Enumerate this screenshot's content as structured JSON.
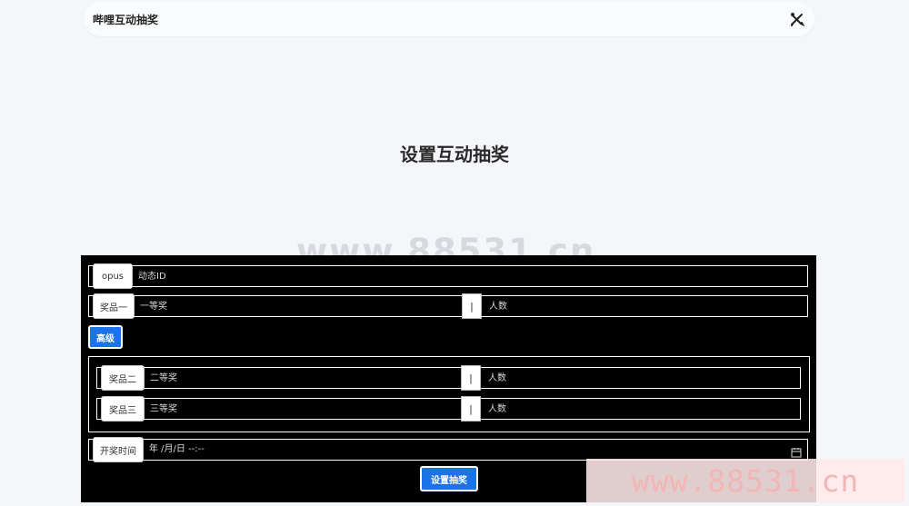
{
  "header": {
    "brand": "哔哩互动抽奖",
    "tool_icon": "tools-icon"
  },
  "page": {
    "title": "设置互动抽奖"
  },
  "watermarks": {
    "center": "www.88531.cn",
    "bottom": "www.88531.cn"
  },
  "form": {
    "opus": {
      "label": "opus",
      "placeholder": "动态ID"
    },
    "prize1": {
      "label": "奖品一",
      "name_placeholder": "一等奖",
      "separator": "|",
      "count_placeholder": "人数"
    },
    "advanced_button": "高级",
    "prize2": {
      "label": "奖品二",
      "name_placeholder": "二等奖",
      "separator": "|",
      "count_placeholder": "人数"
    },
    "prize3": {
      "label": "奖品三",
      "name_placeholder": "三等奖",
      "separator": "|",
      "count_placeholder": "人数"
    },
    "draw_time": {
      "label": "开奖时间",
      "value": "年 /月/日 --:--",
      "icon": "calendar-icon"
    },
    "submit_button": "设置抽奖"
  },
  "colors": {
    "accent": "#1a73e8",
    "background": "#f5f6fa",
    "form_background": "#000000"
  }
}
